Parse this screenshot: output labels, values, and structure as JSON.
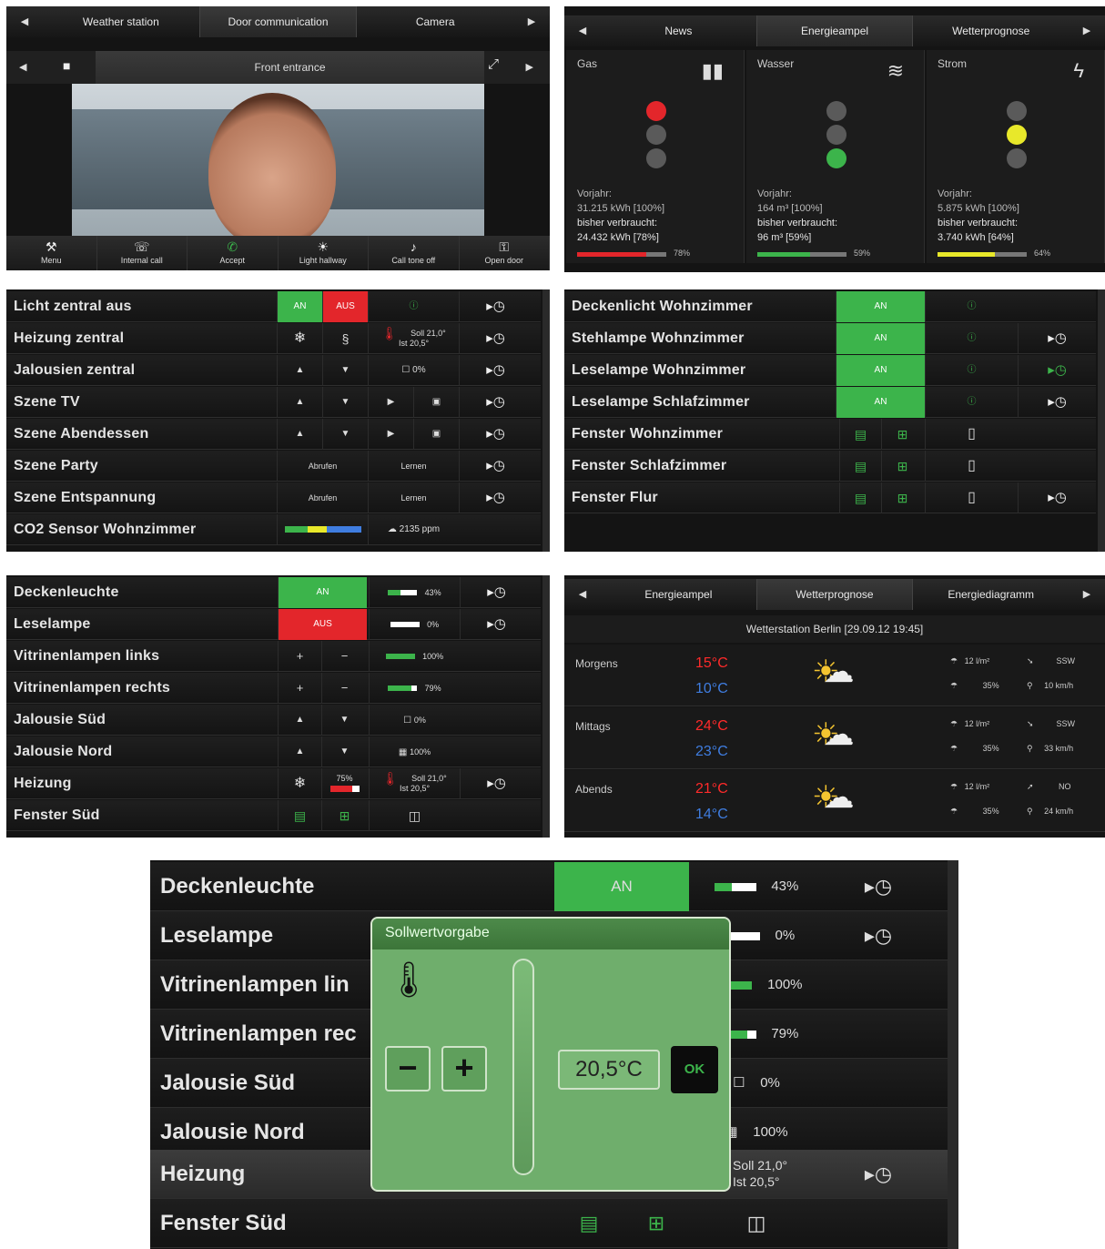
{
  "door": {
    "tabs": [
      "Weather station",
      "Door communication",
      "Camera"
    ],
    "camera_title": "Front entrance",
    "buttons": [
      {
        "label": "Menu",
        "icon": "wrench-icon"
      },
      {
        "label": "Internal call",
        "icon": "phone-icon"
      },
      {
        "label": "Accept",
        "icon": "handset-icon"
      },
      {
        "label": "Light hallway",
        "icon": "light-icon"
      },
      {
        "label": "Call tone off",
        "icon": "bell-off-icon"
      },
      {
        "label": "Open door",
        "icon": "key-icon"
      }
    ]
  },
  "energy": {
    "tabs": [
      "News",
      "Energieampel",
      "Wetterprognose"
    ],
    "columns": [
      {
        "name": "Gas",
        "prev_label": "Vorjahr:",
        "prev": "31.215 kWh [100%]",
        "used_label": "bisher verbraucht:",
        "used": "24.432 kWh [78%]",
        "pct": "78%",
        "fill": 0.78,
        "bar_color": "#e3262b",
        "light": "red"
      },
      {
        "name": "Wasser",
        "prev_label": "Vorjahr:",
        "prev": "164 m³ [100%]",
        "used_label": "bisher verbraucht:",
        "used": "96 m³ [59%]",
        "pct": "59%",
        "fill": 0.59,
        "bar_color": "#3cb44b",
        "light": "green"
      },
      {
        "name": "Strom",
        "prev_label": "Vorjahr:",
        "prev": "5.875 kWh [100%]",
        "used_label": "bisher verbraucht:",
        "used": "3.740 kWh [64%]",
        "pct": "64%",
        "fill": 0.64,
        "bar_color": "#e8e82a",
        "light": "yellow"
      }
    ]
  },
  "central": {
    "rows": [
      {
        "label": "Licht zentral aus",
        "an": "AN",
        "aus": "AUS"
      },
      {
        "label": "Heizung zentral",
        "soll": "Soll 21,0°",
        "ist": "Ist  20,5°"
      },
      {
        "label": "Jalousien zentral",
        "pct": "0%"
      },
      {
        "label": "Szene TV"
      },
      {
        "label": "Szene Abendessen"
      },
      {
        "label": "Szene Party",
        "abrufen": "Abrufen",
        "lernen": "Lernen"
      },
      {
        "label": "Szene Entspannung",
        "abrufen": "Abrufen",
        "lernen": "Lernen"
      },
      {
        "label": "CO2 Sensor Wohnzimmer",
        "ppm": "2135 ppm"
      }
    ]
  },
  "rooms": {
    "rows": [
      {
        "label": "Deckenlicht Wohnzimmer",
        "an": "AN"
      },
      {
        "label": "Stehlampe Wohnzimmer",
        "an": "AN"
      },
      {
        "label": "Leselampe Wohnzimmer",
        "an": "AN"
      },
      {
        "label": "Leselampe Schlafzimmer",
        "an": "AN"
      },
      {
        "label": "Fenster Wohnzimmer"
      },
      {
        "label": "Fenster Schlafzimmer"
      },
      {
        "label": "Fenster Flur"
      }
    ]
  },
  "living": {
    "rows": [
      {
        "label": "Deckenleuchte",
        "state": "AN",
        "pct": "43%",
        "fill": 0.43
      },
      {
        "label": "Leselampe",
        "state": "AUS",
        "pct": "0%",
        "fill": 0
      },
      {
        "label": "Vitrinenlampen links",
        "pct": "100%",
        "fill": 1
      },
      {
        "label": "Vitrinenlampen rechts",
        "pct": "79%",
        "fill": 0.79
      },
      {
        "label": "Jalousie Süd",
        "pct": "0%"
      },
      {
        "label": "Jalousie Nord",
        "pct": "100%"
      },
      {
        "label": "Heizung",
        "valve": "75%",
        "soll": "Soll 21,0°",
        "ist": "Ist  20,5°"
      },
      {
        "label": "Fenster Süd"
      }
    ]
  },
  "weather": {
    "tabs": [
      "Energieampel",
      "Wetterprognose",
      "Energiediagramm"
    ],
    "station": "Wetterstation Berlin [29.09.12 19:45]",
    "periods": [
      {
        "name": "Morgens",
        "hi": "15°C",
        "lo": "10°C",
        "rain": "12 l/m²",
        "prob": "35%",
        "dir": "SSW",
        "wind": "10 km/h"
      },
      {
        "name": "Mittags",
        "hi": "24°C",
        "lo": "23°C",
        "rain": "12 l/m²",
        "prob": "35%",
        "dir": "SSW",
        "wind": "33 km/h"
      },
      {
        "name": "Abends",
        "hi": "21°C",
        "lo": "14°C",
        "rain": "12 l/m²",
        "prob": "35%",
        "dir": "NO",
        "wind": "24 km/h"
      }
    ]
  },
  "zoom": {
    "rows": [
      {
        "label": "Deckenleuchte",
        "state": "AN",
        "pct": "43%",
        "fill": 0.43
      },
      {
        "label": "Leselampe",
        "pct": "0%",
        "fill": 0
      },
      {
        "label": "Vitrinenlampen lin",
        "pct": "100%",
        "fill": 1
      },
      {
        "label": "Vitrinenlampen rec",
        "pct": "79%",
        "fill": 0.79
      },
      {
        "label": "Jalousie Süd",
        "pct": "0%"
      },
      {
        "label": "Jalousie Nord",
        "pct": "100%"
      },
      {
        "label": "Heizung",
        "soll": "Soll 21,0°",
        "ist": "Ist  20,5°"
      },
      {
        "label": "Fenster Süd"
      }
    ],
    "dialog": {
      "title": "Sollwertvorgabe",
      "minus": "−",
      "plus": "+",
      "value": "20,5°C",
      "ok": "OK"
    }
  }
}
